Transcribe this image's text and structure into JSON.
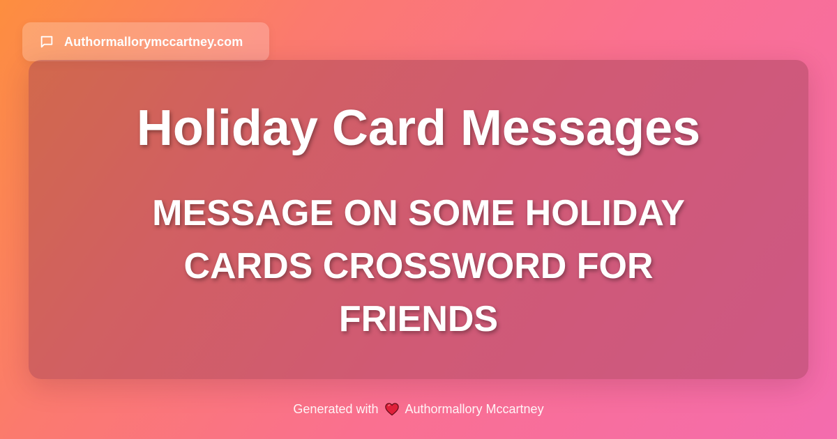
{
  "site": {
    "name": "Authormallorymccartney.com",
    "icon": "chat-bubble-icon"
  },
  "card": {
    "title": "Holiday Card Messages",
    "subtitle": "MESSAGE ON SOME HOLIDAY CARDS CROSSWORD FOR FRIENDS"
  },
  "footer": {
    "prefix": "Generated with",
    "icon": "heart-icon",
    "author": "Authormallory Mccartney"
  },
  "colors": {
    "gradient_start": "#fd8e3f",
    "gradient_end": "#f46cae",
    "heart": "#e0203a",
    "text": "#ffffff"
  }
}
